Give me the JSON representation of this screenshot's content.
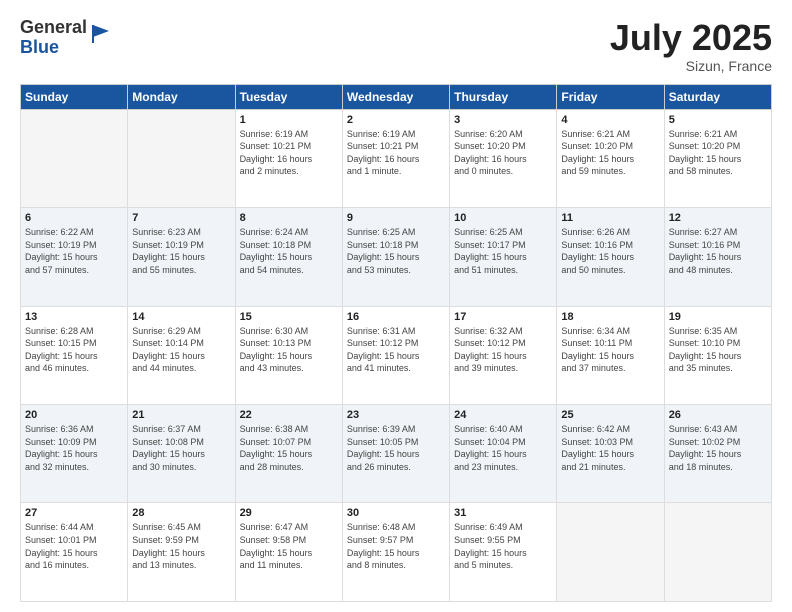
{
  "header": {
    "logo_general": "General",
    "logo_blue": "Blue",
    "month": "July 2025",
    "location": "Sizun, France"
  },
  "weekdays": [
    "Sunday",
    "Monday",
    "Tuesday",
    "Wednesday",
    "Thursday",
    "Friday",
    "Saturday"
  ],
  "weeks": [
    [
      {
        "day": "",
        "info": ""
      },
      {
        "day": "",
        "info": ""
      },
      {
        "day": "1",
        "info": "Sunrise: 6:19 AM\nSunset: 10:21 PM\nDaylight: 16 hours\nand 2 minutes."
      },
      {
        "day": "2",
        "info": "Sunrise: 6:19 AM\nSunset: 10:21 PM\nDaylight: 16 hours\nand 1 minute."
      },
      {
        "day": "3",
        "info": "Sunrise: 6:20 AM\nSunset: 10:20 PM\nDaylight: 16 hours\nand 0 minutes."
      },
      {
        "day": "4",
        "info": "Sunrise: 6:21 AM\nSunset: 10:20 PM\nDaylight: 15 hours\nand 59 minutes."
      },
      {
        "day": "5",
        "info": "Sunrise: 6:21 AM\nSunset: 10:20 PM\nDaylight: 15 hours\nand 58 minutes."
      }
    ],
    [
      {
        "day": "6",
        "info": "Sunrise: 6:22 AM\nSunset: 10:19 PM\nDaylight: 15 hours\nand 57 minutes."
      },
      {
        "day": "7",
        "info": "Sunrise: 6:23 AM\nSunset: 10:19 PM\nDaylight: 15 hours\nand 55 minutes."
      },
      {
        "day": "8",
        "info": "Sunrise: 6:24 AM\nSunset: 10:18 PM\nDaylight: 15 hours\nand 54 minutes."
      },
      {
        "day": "9",
        "info": "Sunrise: 6:25 AM\nSunset: 10:18 PM\nDaylight: 15 hours\nand 53 minutes."
      },
      {
        "day": "10",
        "info": "Sunrise: 6:25 AM\nSunset: 10:17 PM\nDaylight: 15 hours\nand 51 minutes."
      },
      {
        "day": "11",
        "info": "Sunrise: 6:26 AM\nSunset: 10:16 PM\nDaylight: 15 hours\nand 50 minutes."
      },
      {
        "day": "12",
        "info": "Sunrise: 6:27 AM\nSunset: 10:16 PM\nDaylight: 15 hours\nand 48 minutes."
      }
    ],
    [
      {
        "day": "13",
        "info": "Sunrise: 6:28 AM\nSunset: 10:15 PM\nDaylight: 15 hours\nand 46 minutes."
      },
      {
        "day": "14",
        "info": "Sunrise: 6:29 AM\nSunset: 10:14 PM\nDaylight: 15 hours\nand 44 minutes."
      },
      {
        "day": "15",
        "info": "Sunrise: 6:30 AM\nSunset: 10:13 PM\nDaylight: 15 hours\nand 43 minutes."
      },
      {
        "day": "16",
        "info": "Sunrise: 6:31 AM\nSunset: 10:12 PM\nDaylight: 15 hours\nand 41 minutes."
      },
      {
        "day": "17",
        "info": "Sunrise: 6:32 AM\nSunset: 10:12 PM\nDaylight: 15 hours\nand 39 minutes."
      },
      {
        "day": "18",
        "info": "Sunrise: 6:34 AM\nSunset: 10:11 PM\nDaylight: 15 hours\nand 37 minutes."
      },
      {
        "day": "19",
        "info": "Sunrise: 6:35 AM\nSunset: 10:10 PM\nDaylight: 15 hours\nand 35 minutes."
      }
    ],
    [
      {
        "day": "20",
        "info": "Sunrise: 6:36 AM\nSunset: 10:09 PM\nDaylight: 15 hours\nand 32 minutes."
      },
      {
        "day": "21",
        "info": "Sunrise: 6:37 AM\nSunset: 10:08 PM\nDaylight: 15 hours\nand 30 minutes."
      },
      {
        "day": "22",
        "info": "Sunrise: 6:38 AM\nSunset: 10:07 PM\nDaylight: 15 hours\nand 28 minutes."
      },
      {
        "day": "23",
        "info": "Sunrise: 6:39 AM\nSunset: 10:05 PM\nDaylight: 15 hours\nand 26 minutes."
      },
      {
        "day": "24",
        "info": "Sunrise: 6:40 AM\nSunset: 10:04 PM\nDaylight: 15 hours\nand 23 minutes."
      },
      {
        "day": "25",
        "info": "Sunrise: 6:42 AM\nSunset: 10:03 PM\nDaylight: 15 hours\nand 21 minutes."
      },
      {
        "day": "26",
        "info": "Sunrise: 6:43 AM\nSunset: 10:02 PM\nDaylight: 15 hours\nand 18 minutes."
      }
    ],
    [
      {
        "day": "27",
        "info": "Sunrise: 6:44 AM\nSunset: 10:01 PM\nDaylight: 15 hours\nand 16 minutes."
      },
      {
        "day": "28",
        "info": "Sunrise: 6:45 AM\nSunset: 9:59 PM\nDaylight: 15 hours\nand 13 minutes."
      },
      {
        "day": "29",
        "info": "Sunrise: 6:47 AM\nSunset: 9:58 PM\nDaylight: 15 hours\nand 11 minutes."
      },
      {
        "day": "30",
        "info": "Sunrise: 6:48 AM\nSunset: 9:57 PM\nDaylight: 15 hours\nand 8 minutes."
      },
      {
        "day": "31",
        "info": "Sunrise: 6:49 AM\nSunset: 9:55 PM\nDaylight: 15 hours\nand 5 minutes."
      },
      {
        "day": "",
        "info": ""
      },
      {
        "day": "",
        "info": ""
      }
    ]
  ]
}
